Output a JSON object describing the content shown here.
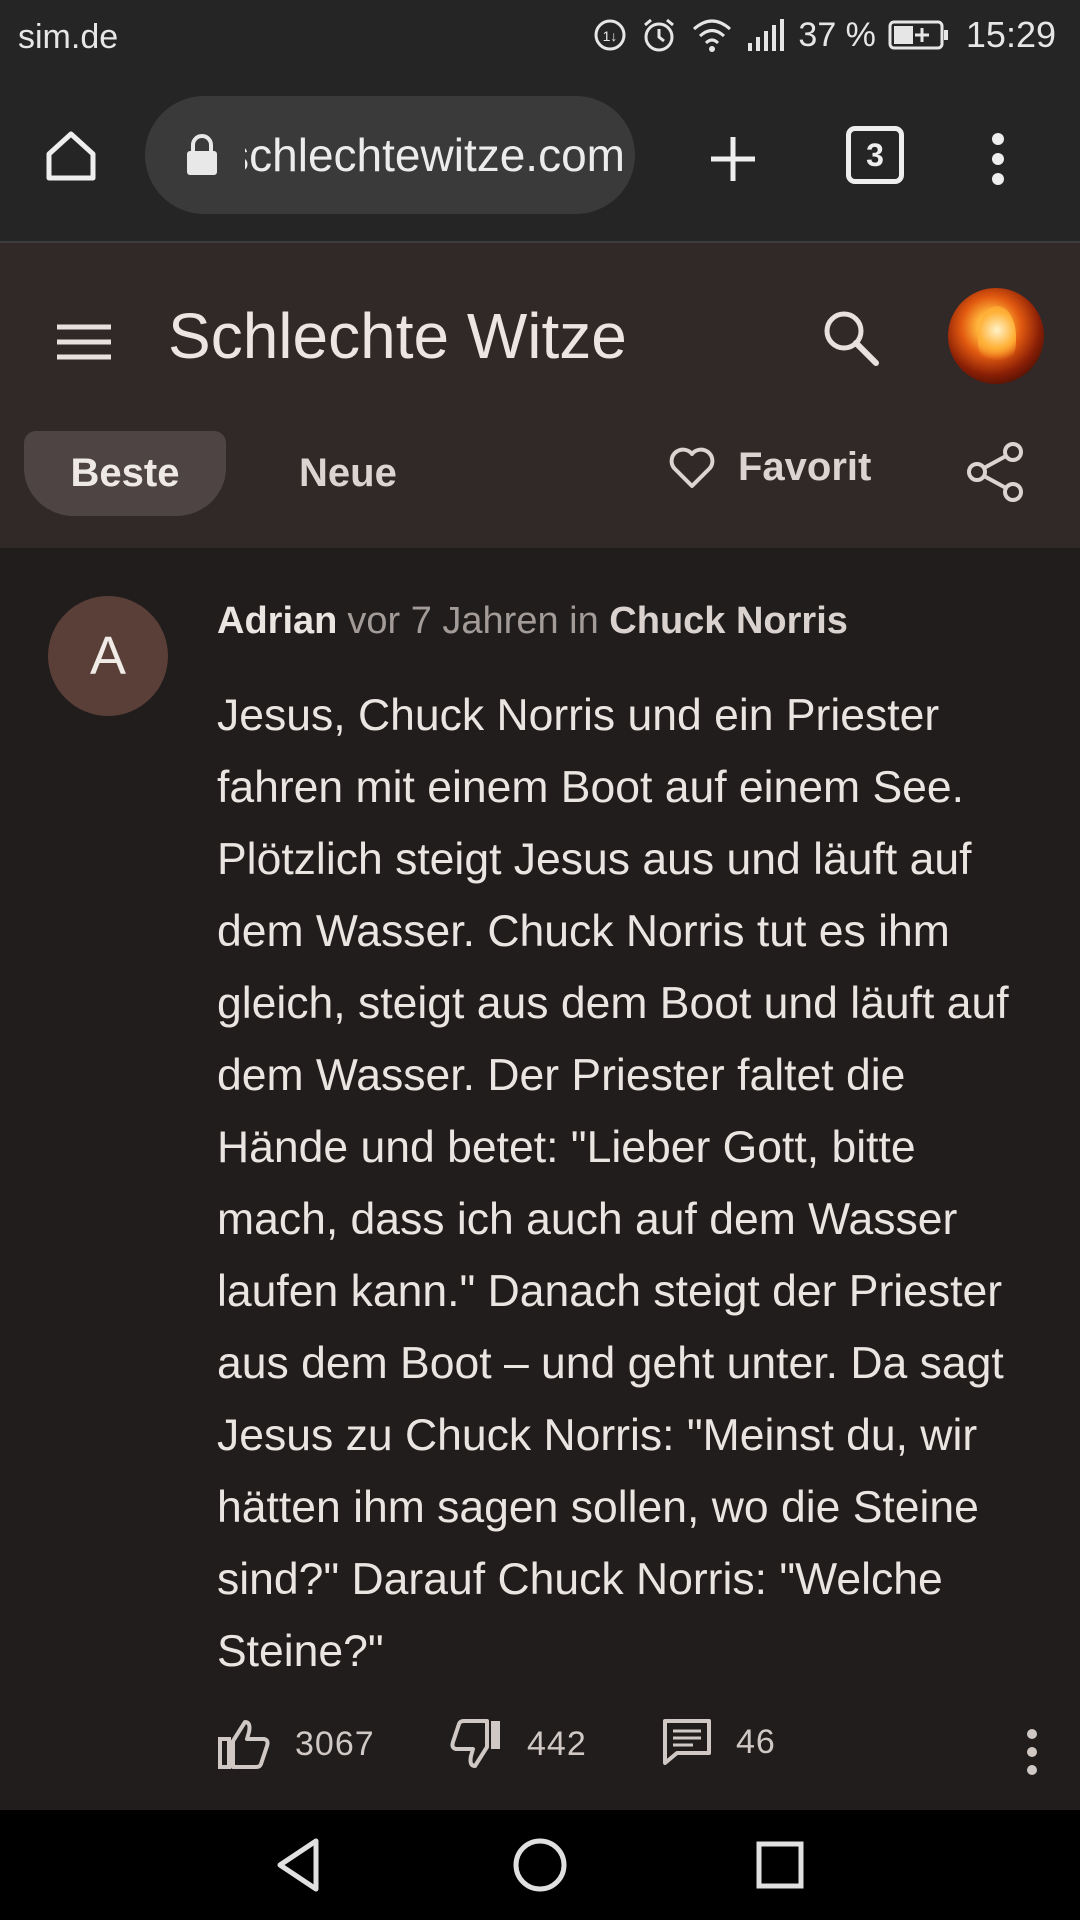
{
  "status_bar": {
    "site": "sim.de",
    "battery_percent": "37 %",
    "time": "15:29",
    "icons": [
      "data-saver-icon",
      "alarm-icon",
      "wifi-icon",
      "signal-icon",
      "battery-icon"
    ]
  },
  "browser": {
    "url": "schlechtewitze.com",
    "tab_count": "3",
    "icons": [
      "home-icon",
      "lock-icon",
      "plus-icon",
      "tab-switcher-icon",
      "more-vert-icon"
    ]
  },
  "app": {
    "title": "Schlechte Witze",
    "tabs": [
      {
        "label": "Beste",
        "active": true
      },
      {
        "label": "Neue",
        "active": false
      }
    ],
    "favorite_label": "Favorit"
  },
  "post": {
    "avatar_letter": "A",
    "author": "Adrian",
    "time": "vor 7 Jahren in",
    "category": "Chuck Norris",
    "text": "Jesus, Chuck Norris und ein Priester fahren mit einem Boot auf einem See. Plötzlich steigt Jesus aus und läuft auf dem Wasser. Chuck Norris tut es ihm gleich, steigt aus dem Boot und läuft auf dem Wasser. Der Priester faltet die Hände und betet: \"Lieber Gott, bitte mach, dass ich auch auf dem Wasser laufen kann.\" Danach steigt der Priester aus dem Boot – und geht unter. Da sagt Jesus zu Chuck Norris: \"Meinst du, wir hätten ihm sagen sollen, wo die Steine sind?\" Darauf Chuck Norris: \"Welche Steine?\"",
    "likes": "3067",
    "dislikes": "442",
    "comments": "46"
  },
  "colors": {
    "page_bg": "#201d1c",
    "appbar_bg": "#302928",
    "browser_bg": "#252525",
    "active_tab_bg": "#4d4443",
    "avatar_bg": "#5a3f38"
  }
}
